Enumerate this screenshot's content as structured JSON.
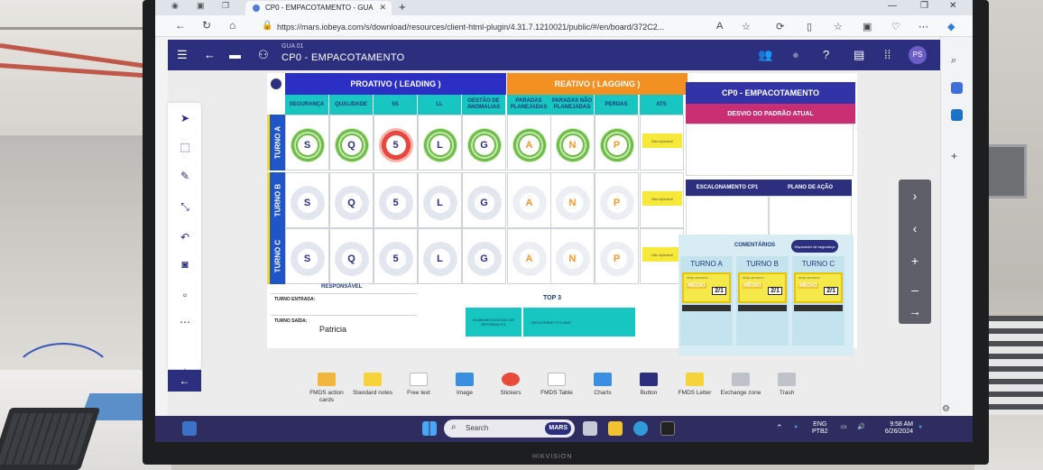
{
  "browser": {
    "tab_title": "CP0 - EMPACOTAMENTO - GUA",
    "url": "https://mars.iobeya.com/s/download/resources/client-html-plugin/4.31.7.1210021/public/#/en/board/372C2..."
  },
  "app": {
    "breadcrumb": "GUA 01",
    "board_title": "CP0 - EMPACOTAMENTO",
    "avatar_initials": "PS"
  },
  "board": {
    "proativo": "PROATIVO ( LEADING )",
    "reativo": "REATIVO ( LAGGING )",
    "cp0_title": "CP0 - EMPACOTAMENTO",
    "columns": [
      "SEGURANÇA",
      "QUALIDADE",
      "5S",
      "LL",
      "GESTÃO DE ANOMALIAS",
      "PARADAS PLANEJADAS",
      "PARADAS NÃO PLANEJADAS",
      "PERDAS",
      "ATS"
    ],
    "shifts": [
      "TURNO A",
      "TURNO B",
      "TURNO C"
    ],
    "letters": [
      "S",
      "Q",
      "5",
      "L",
      "G",
      "A",
      "N",
      "P"
    ],
    "ats_note": "Não Aplicável",
    "desvio": "DESVIO DO PADRÃO ATUAL",
    "escalonamento": "ESCALONAMENTO CP1",
    "plano": "PLANO DE AÇÃO",
    "responsavel": "RESPONSÁVEL",
    "turno_entrada": "TURNO ENTRADA:",
    "turno_saida": "TURNO SAÍDA:",
    "saida_name": "Patricia",
    "top3": "TOP 3",
    "top3_notes": [
      "ELIMINAR EXCESSO DE REFORMA N°1",
      "RECUPERAR O PLANO",
      ""
    ],
    "comentarios": "COMENTÁRIOS",
    "disparador": "Disparador de segurança",
    "comment_cols": [
      "TURNO A",
      "TURNO B",
      "TURNO C"
    ],
    "risk_label": "NÍVEL DE RISCO",
    "risk_level": "MÉDIO",
    "risk_value": "2/1"
  },
  "toolbar": [
    {
      "label": "FMDS action cards",
      "color": "#f3b63c"
    },
    {
      "label": "Standard notes",
      "color": "#f7d33a"
    },
    {
      "label": "Free text",
      "color": "#ffffff"
    },
    {
      "label": "Image",
      "color": "#3a8fe0"
    },
    {
      "label": "Stickers",
      "color": "#e64b3c"
    },
    {
      "label": "FMDS Table",
      "color": "#ffffff"
    },
    {
      "label": "Charts",
      "color": "#3a8fe0"
    },
    {
      "label": "Button",
      "color": "#2b2f7e"
    },
    {
      "label": "FMDS Letter",
      "color": "#f7d33a"
    },
    {
      "label": "Exchange zone",
      "color": "#bfc3c9"
    },
    {
      "label": "Trash",
      "color": "#bfc3c9"
    }
  ],
  "taskbar": {
    "search_placeholder": "Search",
    "search_badge": "MARS",
    "lang": "ENG",
    "layout": "PTB2",
    "time": "9:58 AM",
    "date": "6/26/2024"
  }
}
